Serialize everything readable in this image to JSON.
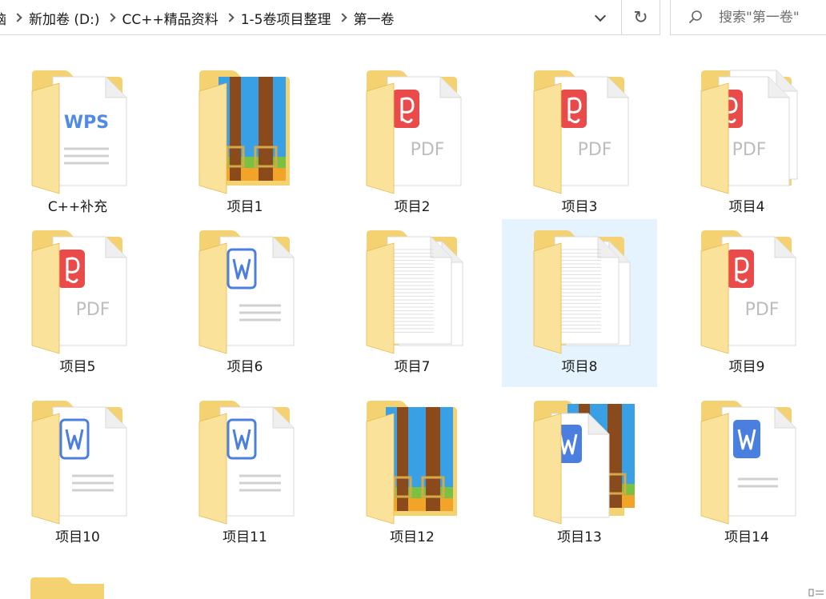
{
  "breadcrumb": {
    "items": [
      "脑",
      "新加卷 (D:)",
      "CC++精品资料",
      "1-5卷项目整理",
      "第一卷"
    ]
  },
  "search": {
    "placeholder": "搜索\"第一卷\""
  },
  "toolbar": {
    "refresh_icon": "refresh-icon",
    "dropdown_icon": "chevron-down-icon"
  },
  "colors": {
    "folder_back": "#f4d171",
    "folder_front": "#fbe29a",
    "folder_edge": "#e6b94d",
    "pdf_red": "#e94b4b",
    "word_blue": "#4a7fe0",
    "wps_blue": "#4f8be6",
    "selected_bg": "#e5f3ff"
  },
  "items": [
    {
      "name": "C++补充",
      "type": "wps"
    },
    {
      "name": "项目1",
      "type": "zip"
    },
    {
      "name": "项目2",
      "type": "pdf"
    },
    {
      "name": "项目3",
      "type": "pdf"
    },
    {
      "name": "项目4",
      "type": "pdfstack"
    },
    {
      "name": "项目5",
      "type": "pdf"
    },
    {
      "name": "项目6",
      "type": "word"
    },
    {
      "name": "项目7",
      "type": "docs"
    },
    {
      "name": "项目8",
      "type": "docs",
      "selected": true
    },
    {
      "name": "项目9",
      "type": "pdf"
    },
    {
      "name": "项目10",
      "type": "word"
    },
    {
      "name": "项目11",
      "type": "word"
    },
    {
      "name": "项目12",
      "type": "zip"
    },
    {
      "name": "项目13",
      "type": "wordzip"
    },
    {
      "name": "项目14",
      "type": "wordblue"
    },
    {
      "name": "",
      "type": "partial"
    }
  ]
}
